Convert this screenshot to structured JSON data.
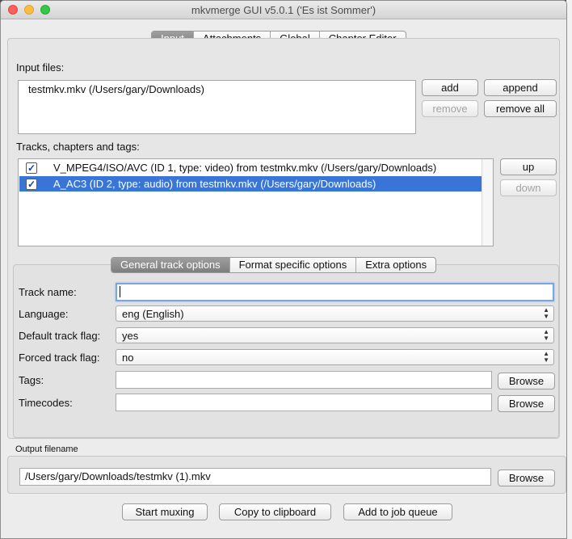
{
  "window": {
    "title": "mkvmerge GUI v5.0.1 ('Es ist Sommer')"
  },
  "main_tabs": [
    "Input",
    "Attachments",
    "Global",
    "Chapter Editor"
  ],
  "input_files": {
    "label": "Input files:",
    "items": [
      "testmkv.mkv (/Users/gary/Downloads)"
    ],
    "buttons": {
      "add": "add",
      "append": "append",
      "remove": "remove",
      "remove_all": "remove all"
    }
  },
  "tracks": {
    "label": "Tracks, chapters and tags:",
    "items": [
      {
        "text": "V_MPEG4/ISO/AVC (ID 1, type: video) from testmkv.mkv (/Users/gary/Downloads)",
        "checked": true,
        "selected": false
      },
      {
        "text": "A_AC3 (ID 2, type: audio) from testmkv.mkv (/Users/gary/Downloads)",
        "checked": true,
        "selected": true
      }
    ],
    "buttons": {
      "up": "up",
      "down": "down"
    }
  },
  "track_tabs": [
    "General track options",
    "Format specific options",
    "Extra options"
  ],
  "options": {
    "track_name_label": "Track name:",
    "track_name_value": "",
    "language_label": "Language:",
    "language_value": "eng (English)",
    "default_flag_label": "Default track flag:",
    "default_flag_value": "yes",
    "forced_flag_label": "Forced track flag:",
    "forced_flag_value": "no",
    "tags_label": "Tags:",
    "tags_value": "",
    "timecodes_label": "Timecodes:",
    "timecodes_value": "",
    "browse": "Browse"
  },
  "output": {
    "label": "Output filename",
    "value": "/Users/gary/Downloads/testmkv (1).mkv",
    "browse": "Browse"
  },
  "actions": {
    "start": "Start muxing",
    "copy": "Copy to clipboard",
    "queue": "Add to job queue"
  }
}
